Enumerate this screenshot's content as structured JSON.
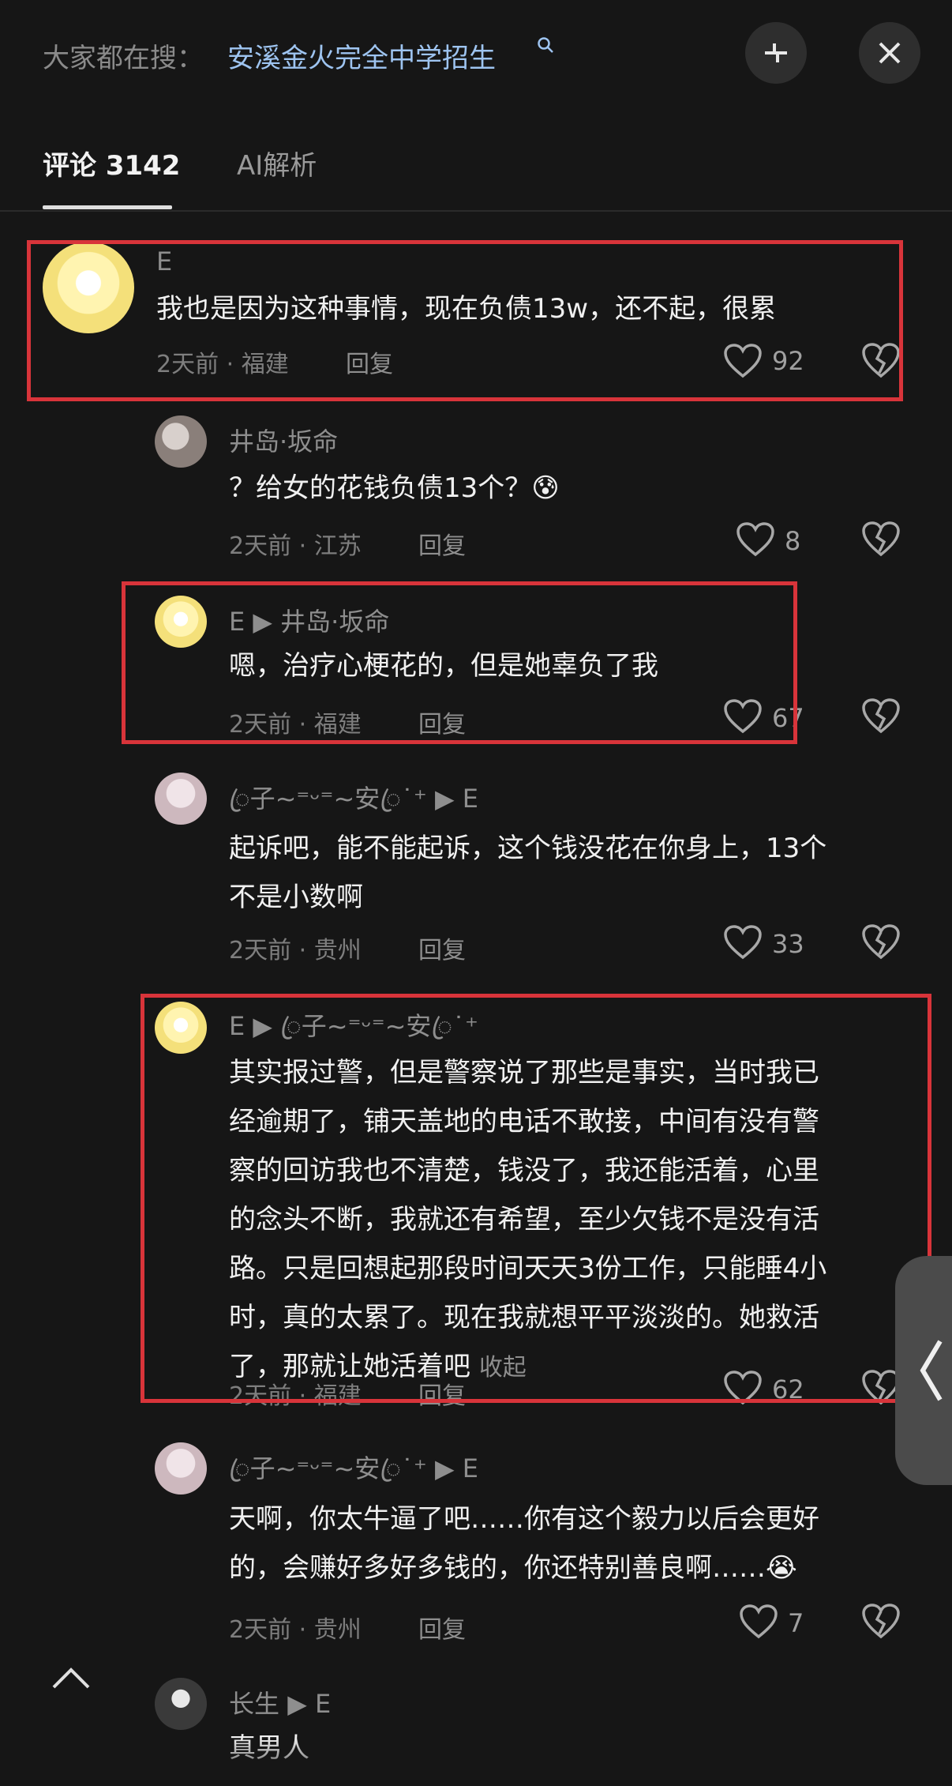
{
  "header": {
    "search_prefix": "大家都在搜：",
    "search_query": "安溪金火完全中学招生",
    "minimize_icon": "collapse-icon",
    "close_icon": "close-icon"
  },
  "tabs": [
    {
      "label": "评论 3142",
      "active": true
    },
    {
      "label": "AI解析",
      "active": false
    }
  ],
  "comments": [
    {
      "author": "E",
      "text": "我也是因为这种事情，现在负债13w，还不起，很累",
      "time": "2天前",
      "location": "福建",
      "reply": "回复",
      "likes": "92"
    },
    {
      "author": "井岛·坂命",
      "text": "？给女的花钱负债13个？",
      "emoji": "😰",
      "time": "2天前",
      "location": "江苏",
      "reply": "回复",
      "likes": "8"
    },
    {
      "author": "E",
      "reply_to": "井岛·坂命",
      "text": "嗯，治疗心梗花的，但是她辜负了我",
      "time": "2天前",
      "location": "福建",
      "reply": "回复",
      "likes": "67"
    },
    {
      "author": "ꦿ子~⁼ᵕ⁼~安ꦿ˙⁺",
      "reply_to": "E",
      "text_lines": [
        "起诉吧，能不能起诉，这个钱没花在你身上，13个",
        "不是小数啊"
      ],
      "time": "2天前",
      "location": "贵州",
      "reply": "回复",
      "likes": "33"
    },
    {
      "author": "E",
      "reply_to": "ꦿ子~⁼ᵕ⁼~安ꦿ˙⁺",
      "text_lines": [
        "其实报过警，但是警察说了那些是事实，当时我已",
        "经逾期了，铺天盖地的电话不敢接，中间有没有警",
        "察的回访我也不清楚，钱没了，我还能活着，心里",
        "的念头不断，我就还有希望，至少欠钱不是没有活",
        "路。只是回想起那段时间天天3份工作，只能睡4小",
        "时，真的太累了。现在我就想平平淡淡的。她救活",
        "了，那就让她活着吧"
      ],
      "collapse": "收起",
      "time": "2天前",
      "location": "福建",
      "reply": "回复",
      "likes": "62"
    },
    {
      "author": "ꦿ子~⁼ᵕ⁼~安ꦿ˙⁺",
      "reply_to": "E",
      "text_lines": [
        "天啊，你太牛逼了吧……你有这个毅力以后会更好",
        "的，会赚好多好多钱的，你还特别善良啊……"
      ],
      "emoji": "😭",
      "time": "2天前",
      "location": "贵州",
      "reply": "回复",
      "likes": "7"
    },
    {
      "author": "长生",
      "reply_to": "E",
      "text": "真男人"
    }
  ],
  "side_handle_icon": "chevron-left-icon",
  "scroll_up_icon": "chevron-up-icon",
  "colors": {
    "background": "#161616",
    "highlight_box": "#d8343a",
    "search_link": "#9ec4f0"
  }
}
